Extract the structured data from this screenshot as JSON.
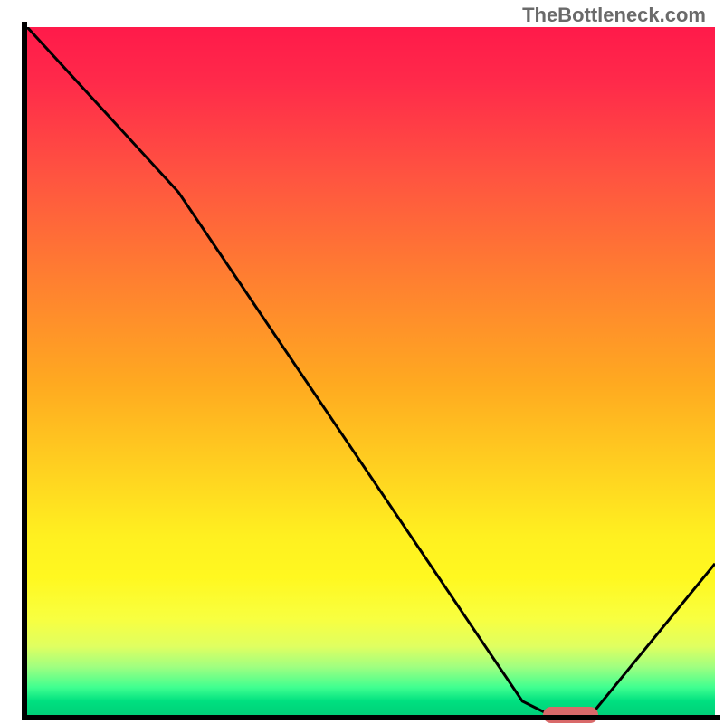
{
  "watermark": "TheBottleneck.com",
  "chart_data": {
    "type": "line",
    "title": "",
    "xlabel": "",
    "ylabel": "",
    "xlim": [
      0,
      100
    ],
    "ylim": [
      0,
      100
    ],
    "series": [
      {
        "name": "curve",
        "stroke": "#000000",
        "points": [
          {
            "x": 0,
            "y": 100
          },
          {
            "x": 22,
            "y": 76
          },
          {
            "x": 72,
            "y": 2
          },
          {
            "x": 76,
            "y": 0
          },
          {
            "x": 82,
            "y": 0
          },
          {
            "x": 100,
            "y": 22
          }
        ]
      }
    ],
    "marker": {
      "name": "highlight",
      "color": "#d96a6a",
      "x_start": 75,
      "x_end": 83,
      "y": 0
    },
    "background_gradient": {
      "top": "#ff1a4a",
      "mid": "#fff020",
      "bottom": "#00d078"
    }
  }
}
